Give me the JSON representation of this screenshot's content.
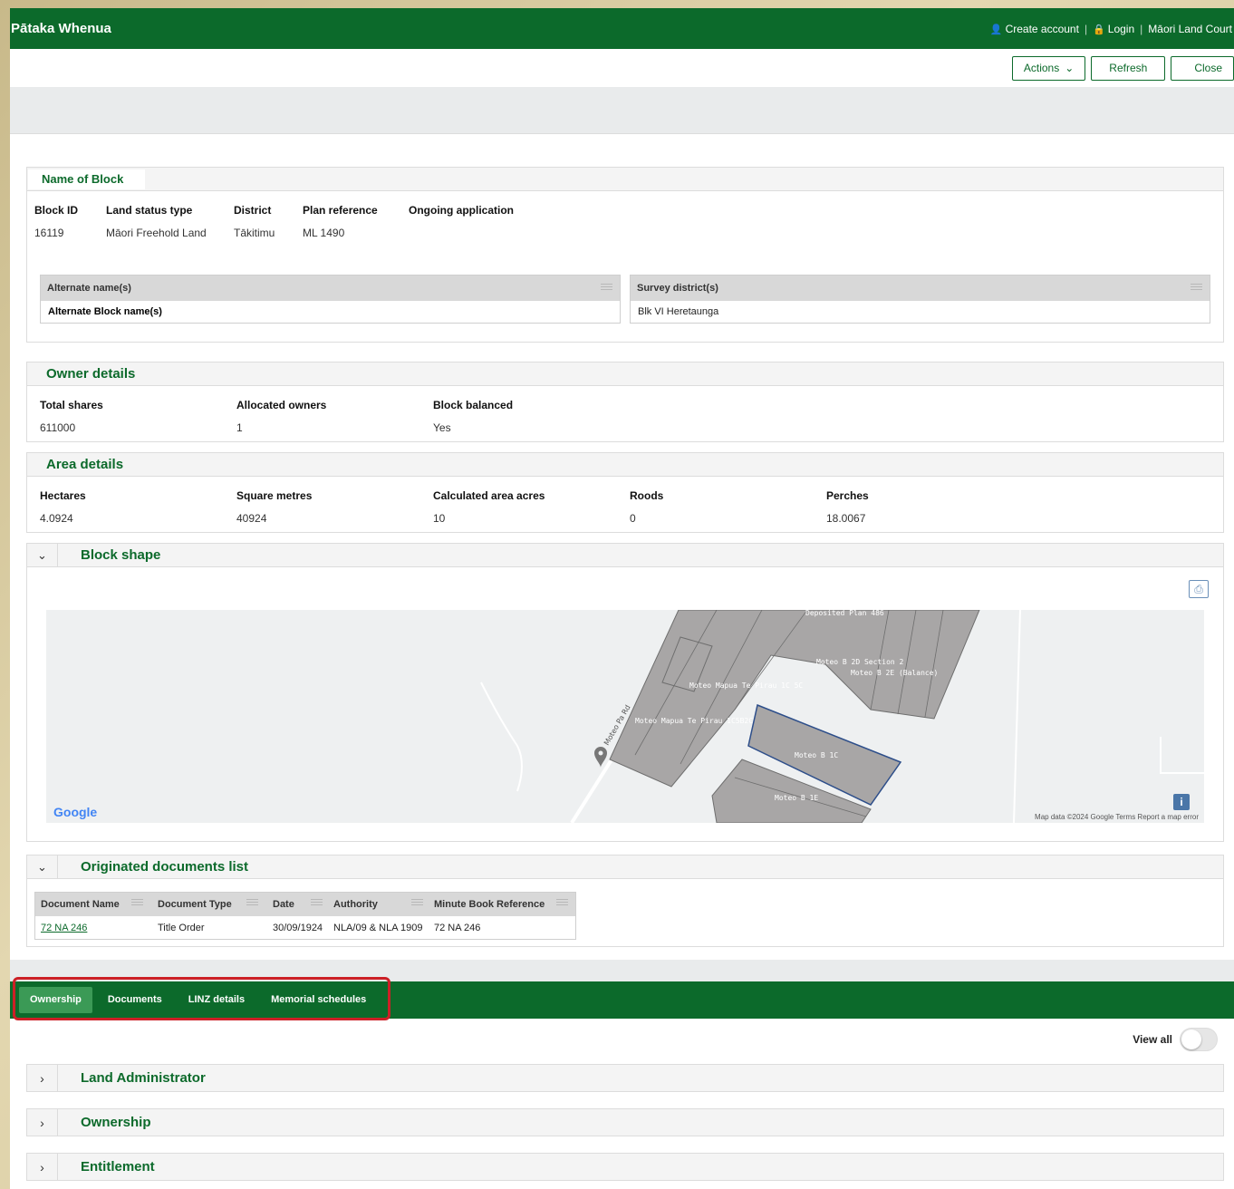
{
  "header": {
    "brand": "Pātaka Whenua",
    "create_account": "Create account",
    "login": "Login",
    "court": "Māori Land Court"
  },
  "toolbar": {
    "actions": "Actions",
    "refresh": "Refresh",
    "close": "Close"
  },
  "block": {
    "title": "Name of Block",
    "labels": {
      "block_id": "Block ID",
      "land_status": "Land status type",
      "district": "District",
      "plan_ref": "Plan reference",
      "ongoing": "Ongoing application"
    },
    "values": {
      "block_id": "16119",
      "land_status": "Māori Freehold Land",
      "district": "Tākitimu",
      "plan_ref": "ML 1490",
      "ongoing": ""
    },
    "alt_names_header": "Alternate name(s)",
    "alt_names_value": "Alternate Block name(s)",
    "survey_header": "Survey district(s)",
    "survey_value": "Blk VI Heretaunga"
  },
  "owner": {
    "title": "Owner details",
    "total_shares_label": "Total shares",
    "total_shares": "611000",
    "allocated_label": "Allocated owners",
    "allocated": "1",
    "balanced_label": "Block balanced",
    "balanced": "Yes"
  },
  "area": {
    "title": "Area details",
    "hectares_label": "Hectares",
    "hectares": "4.0924",
    "sqm_label": "Square metres",
    "sqm": "40924",
    "acres_label": "Calculated area acres",
    "acres": "10",
    "roods_label": "Roods",
    "roods": "0",
    "perches_label": "Perches",
    "perches": "18.0067"
  },
  "shape": {
    "title": "Block shape",
    "google": "Google",
    "map_footer": "Map data ©2024 Google   Terms   Report a map error",
    "road_label": "Moteo Pa Rd",
    "parcel_1c": "Moteo B 1C",
    "parcel_1e": "Moteo B 1E",
    "parcel_mapua": "Moteo Mapua Te Pirau 1C 5C",
    "parcel_2d": "Moteo B 2D Section 2",
    "parcel_dp": "Deposited Plan 486",
    "parcel_bal": "Moteo B 2E (Balance)",
    "parcel_mapua2": "Moteo Mapua Te Pirau 1C5B2C"
  },
  "docs": {
    "title": "Originated documents list",
    "columns": [
      "Document Name",
      "Document Type",
      "Date",
      "Authority",
      "Minute Book Reference"
    ],
    "rows": [
      [
        "72 NA 246",
        "Title Order",
        "30/09/1924",
        "NLA/09 & NLA 1909",
        "72 NA 246"
      ]
    ]
  },
  "tabs": [
    "Ownership",
    "Documents",
    "LINZ details",
    "Memorial schedules"
  ],
  "view_all": "View all",
  "accordions": [
    "Land Administrator",
    "Ownership",
    "Entitlement"
  ]
}
